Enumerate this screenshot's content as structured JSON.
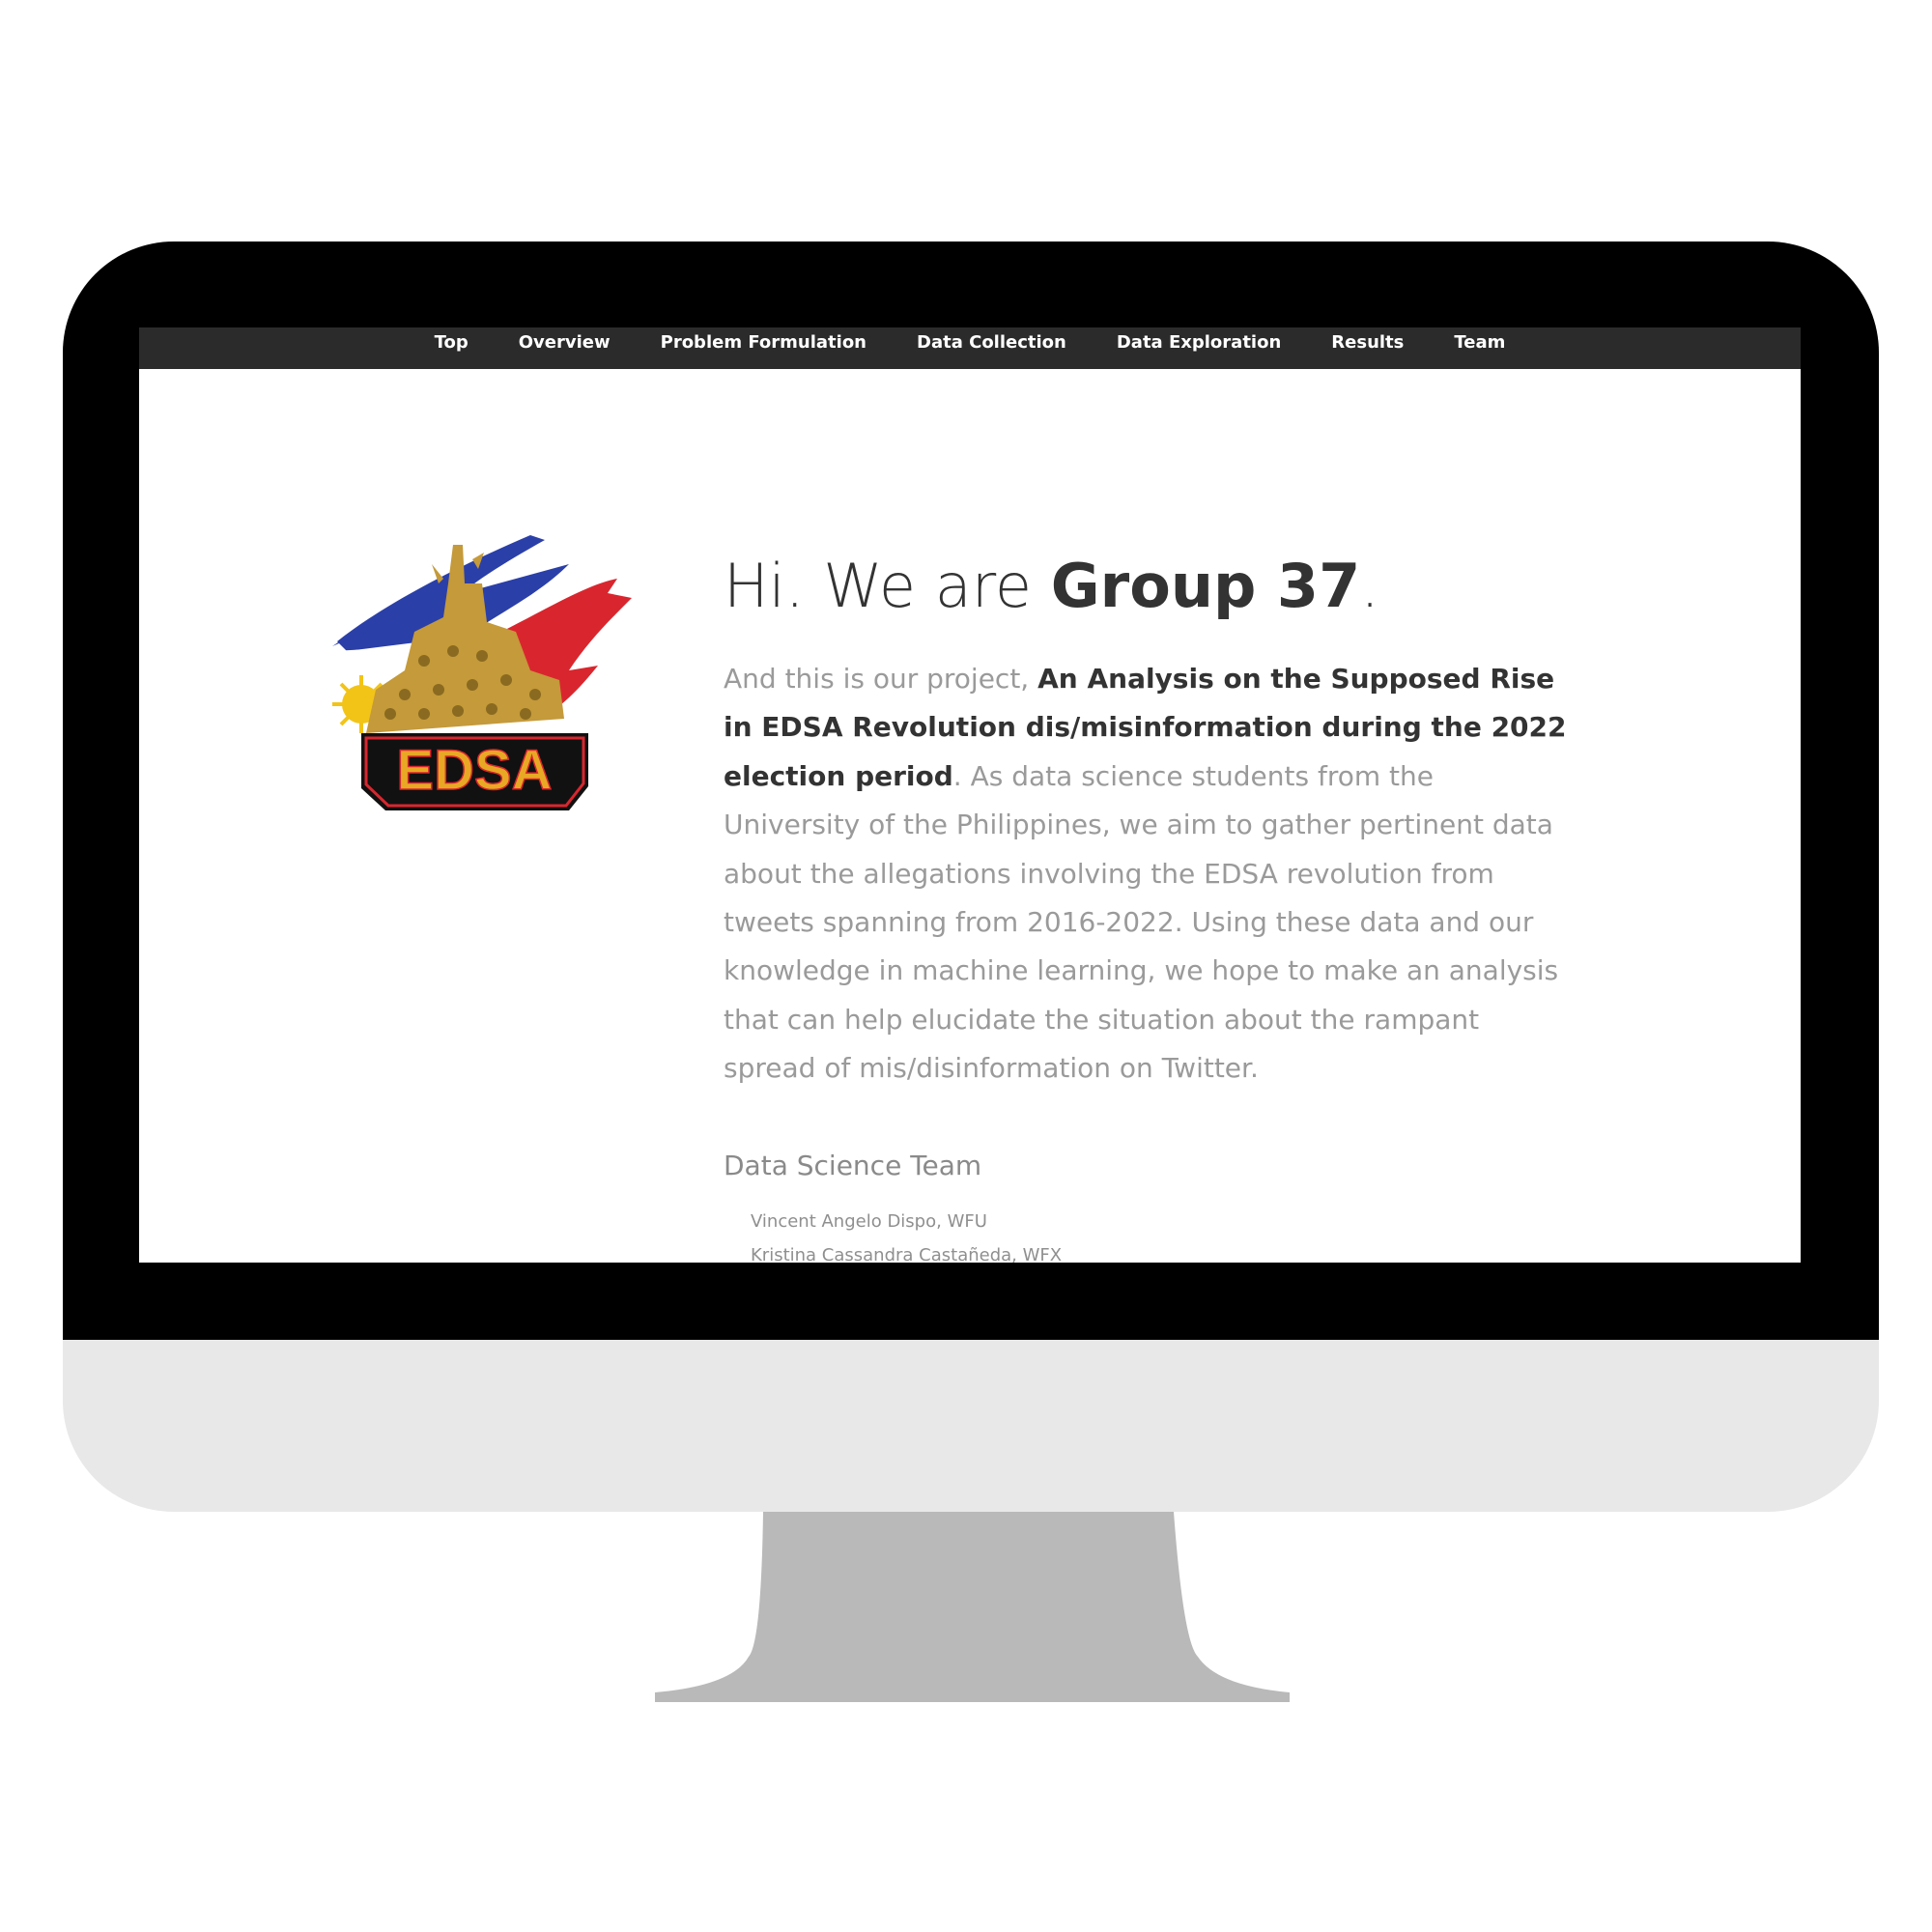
{
  "nav": {
    "items": [
      "Top",
      "Overview",
      "Problem Formulation",
      "Data Collection",
      "Data Exploration",
      "Results",
      "Team"
    ]
  },
  "logo": {
    "text": "EDSA"
  },
  "hero": {
    "greeting": "Hi. We are ",
    "group": "Group 37",
    "period": "."
  },
  "intro": {
    "lead": "And this is our project, ",
    "project_title": "An Analysis on the Supposed Rise in EDSA Revolution dis/misinformation during the 2022 election period",
    "after_title": ".",
    "body": " As data science students from the University of the Philippines, we aim to gather pertinent data about the allegations involving the EDSA revolution from tweets spanning from 2016-2022. Using these data and our knowledge in machine learning, we hope to make an analysis that can help elucidate the situation about the rampant spread of mis/disinformation on Twitter."
  },
  "team": {
    "heading": "Data Science Team",
    "members": [
      "Vincent Angelo Dispo, WFU",
      "Kristina Cassandra Castañeda, WFX"
    ]
  },
  "colors": {
    "navbar": "#2b2b2b",
    "bezel": "#000000",
    "chin": "#e8e8e8",
    "stand": "#b9b9b9",
    "flag_blue": "#2b3fa8",
    "flag_red": "#d9262e",
    "gold": "#d4a537"
  }
}
